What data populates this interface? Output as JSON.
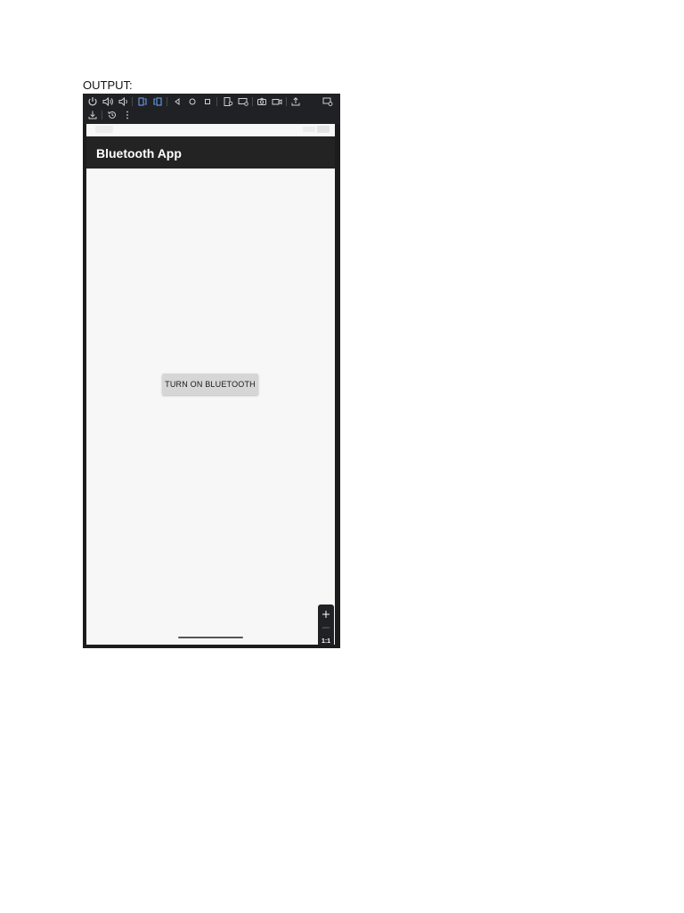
{
  "output_label": "OUTPUT:",
  "emulator": {
    "toolbar": {
      "row1": [
        {
          "icon": "power-icon"
        },
        {
          "icon": "volume-up-icon"
        },
        {
          "icon": "volume-down-icon"
        },
        {
          "icon": "rotate-left-icon"
        },
        {
          "icon": "rotate-right-icon"
        },
        {
          "icon": "back-icon"
        },
        {
          "icon": "home-icon"
        },
        {
          "icon": "overview-icon"
        },
        {
          "icon": "fold-icon"
        },
        {
          "icon": "display-mode-icon"
        },
        {
          "icon": "camera-icon"
        },
        {
          "icon": "screen-record-icon"
        },
        {
          "icon": "share-icon"
        },
        {
          "icon": "snapshot-icon"
        }
      ],
      "row2": [
        {
          "icon": "download-icon"
        },
        {
          "icon": "history-icon"
        },
        {
          "icon": "more-options-icon"
        }
      ]
    },
    "zoom_controls": {
      "zoom_in": "+",
      "zoom_out": "—",
      "ratio_label": "1:1",
      "fit_icon": "fit-screen-icon"
    }
  },
  "app": {
    "title": "Bluetooth App",
    "button_label": "TURN ON BLUETOOTH"
  },
  "colors": {
    "toolbar_bg": "#202124",
    "app_bar_bg": "#232323",
    "screen_bg": "#f7f7f7",
    "button_bg": "#d6d6d6"
  }
}
